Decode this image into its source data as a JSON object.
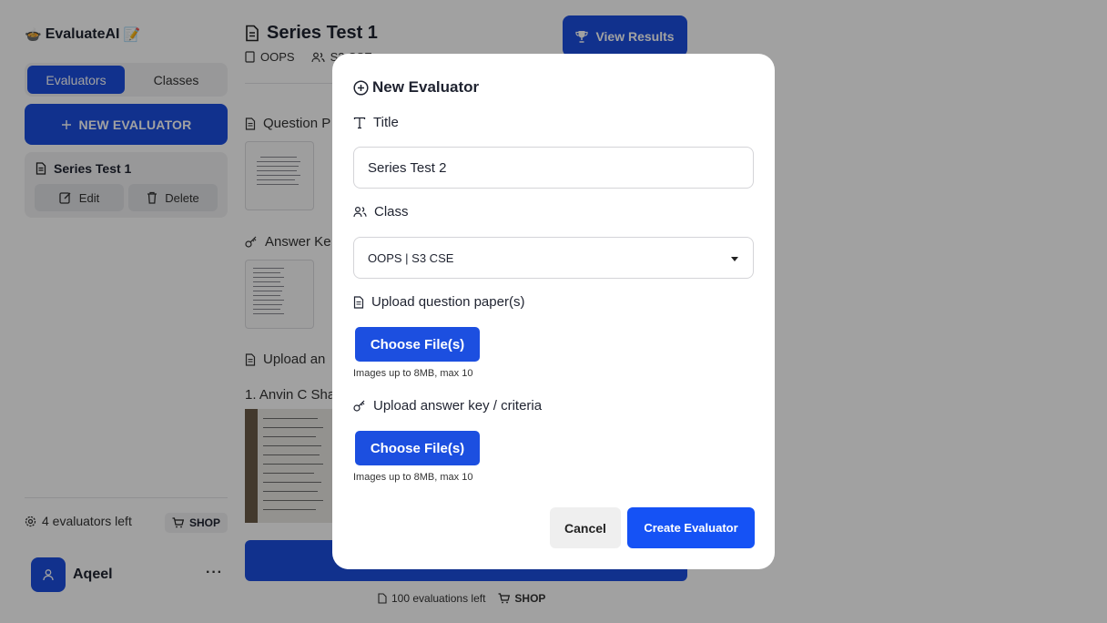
{
  "brand": {
    "name": "EvaluateAI",
    "emoji_left": "🍲",
    "emoji_right": "📝"
  },
  "sidebar": {
    "tabs": [
      {
        "label": "Evaluators",
        "active": true
      },
      {
        "label": "Classes",
        "active": false
      }
    ],
    "new_button": "NEW EVALUATOR",
    "evaluators": [
      {
        "name": "Series Test 1",
        "edit_label": "Edit",
        "delete_label": "Delete"
      }
    ],
    "evaluators_left": "4 evaluators left",
    "shop_label": "SHOP",
    "user": {
      "name": "Aqeel",
      "more": "···"
    }
  },
  "main": {
    "title": "Series Test 1",
    "subject": "OOPS",
    "class_partial": "S3 CSE",
    "view_results": "View Results",
    "question_section": "Question P",
    "answer_section": "Answer Ke",
    "upload_section": "Upload an",
    "student": "1. Anvin C Sha",
    "evaluations_left": "100 evaluations left",
    "shop_label": "SHOP"
  },
  "modal": {
    "title": "New Evaluator",
    "title_label": "Title",
    "title_value": "Series Test 2",
    "class_label": "Class",
    "class_value": "OOPS | S3 CSE",
    "upload_question_label": "Upload question paper(s)",
    "upload_answer_label": "Upload answer key / criteria",
    "choose_files": "Choose File(s)",
    "hint": "Images up to 8MB, max 10",
    "cancel": "Cancel",
    "create": "Create Evaluator"
  },
  "colors": {
    "primary": "#1c4fe0",
    "create_button": "#1552f5",
    "overlay": "rgba(0,0,0,0.37)"
  }
}
